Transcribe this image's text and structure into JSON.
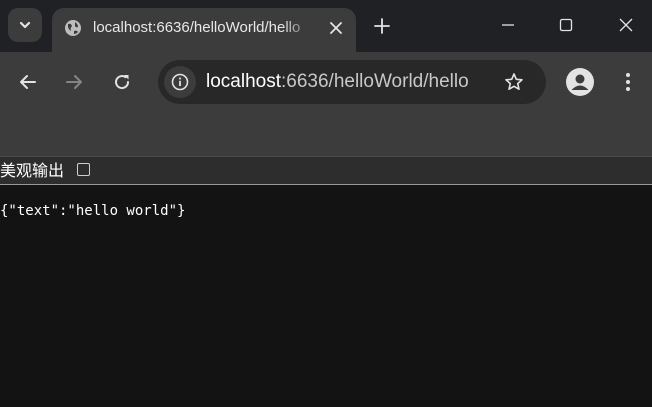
{
  "tab": {
    "title": "localhost:6636/helloWorld/hello"
  },
  "omnibox": {
    "url_host": "localhost",
    "url_rest": ":6636/helloWorld/hello"
  },
  "viewer": {
    "pretty_print_label": "美观输出",
    "pretty_print_checked": false
  },
  "content": {
    "json_text": "{\"text\":\"hello world\"}"
  },
  "colors": {
    "tabstrip": "#202124",
    "toolbar": "#3c3c3c",
    "page": "#131313"
  },
  "icons": [
    "tab-search-icon",
    "globe-icon",
    "close-icon",
    "plus-icon",
    "minimize-icon",
    "maximize-icon",
    "window-close-icon",
    "back-icon",
    "forward-icon",
    "reload-icon",
    "site-info-icon",
    "star-icon",
    "profile-icon",
    "menu-icon"
  ]
}
